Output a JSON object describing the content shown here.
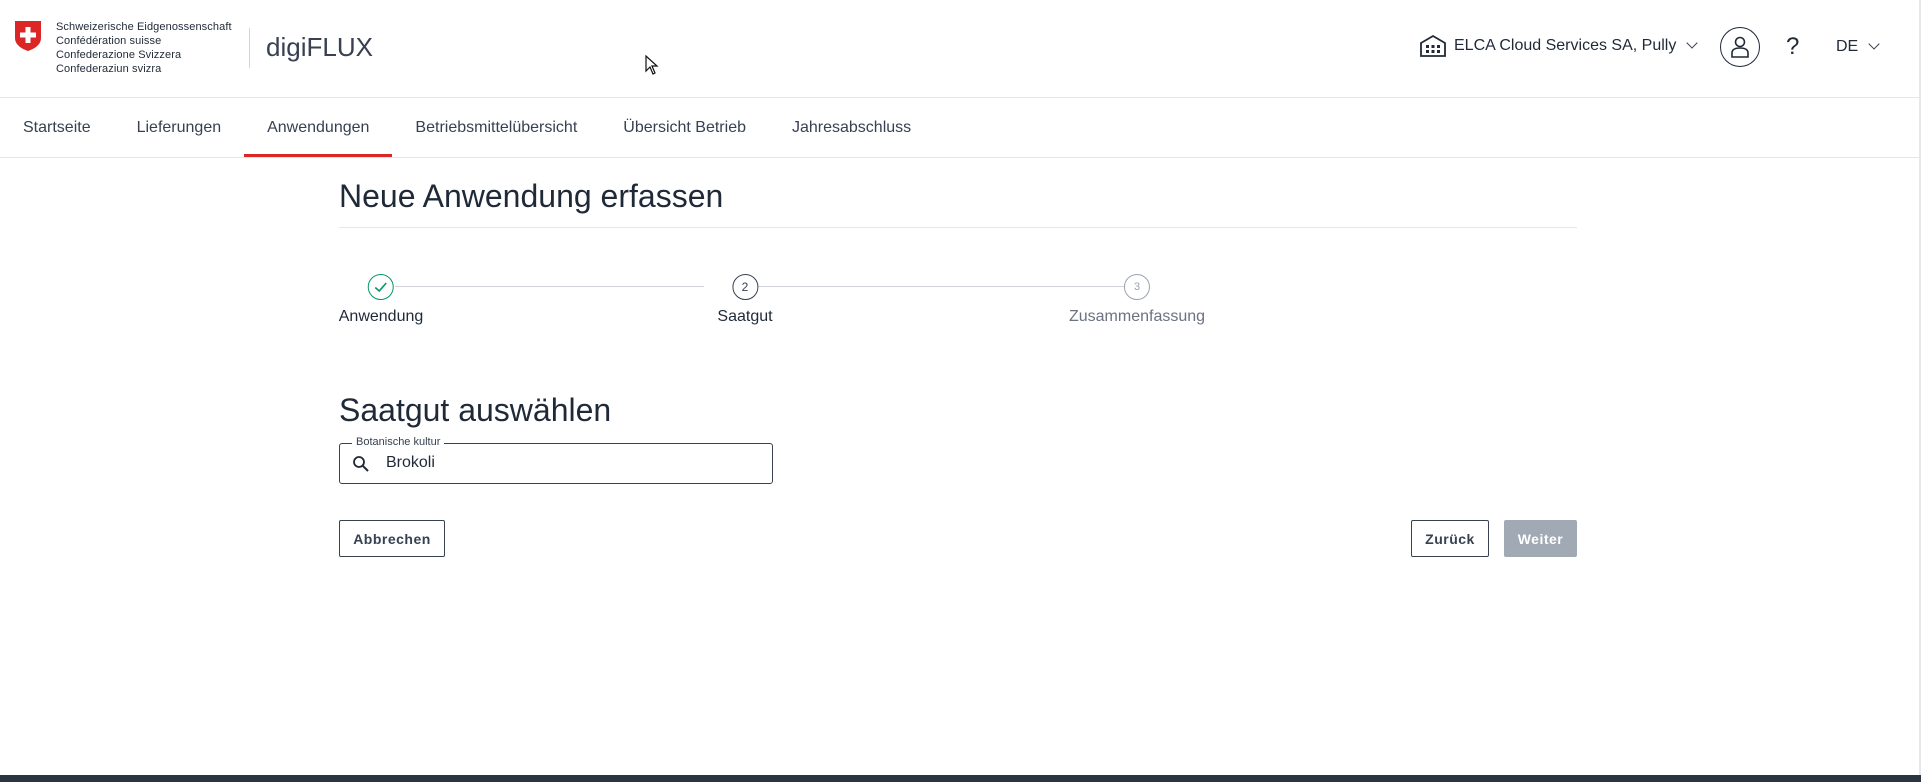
{
  "header": {
    "confederation_lines": [
      "Schweizerische Eidgenossenschaft",
      "Confédération suisse",
      "Confederazione Svizzera",
      "Confederaziun svizra"
    ],
    "app_name": "digiFLUX",
    "organization": "ELCA Cloud Services SA, Pully",
    "help": "?",
    "language": "DE"
  },
  "nav": {
    "items": [
      {
        "label": "Startseite",
        "active": false
      },
      {
        "label": "Lieferungen",
        "active": false
      },
      {
        "label": "Anwendungen",
        "active": true
      },
      {
        "label": "Betriebsmittelübersicht",
        "active": false
      },
      {
        "label": "Übersicht Betrieb",
        "active": false
      },
      {
        "label": "Jahresabschluss",
        "active": false
      }
    ]
  },
  "main": {
    "page_title": "Neue Anwendung erfassen",
    "steps": [
      {
        "label": "Anwendung",
        "state": "done"
      },
      {
        "label": "Saatgut",
        "number": "2",
        "state": "current"
      },
      {
        "label": "Zusammenfassung",
        "number": "3",
        "state": "pending"
      }
    ],
    "section_title": "Saatgut auswählen",
    "botanical_field": {
      "label": "Botanische kultur",
      "value": "Brokoli"
    },
    "buttons": {
      "cancel": "Abbrechen",
      "back": "Zurück",
      "next": "Weiter"
    }
  },
  "colors": {
    "accent_red": "#dc2626",
    "done_green": "#059669",
    "disabled_button": "#a1a9b5",
    "footer": "#2b3542"
  }
}
